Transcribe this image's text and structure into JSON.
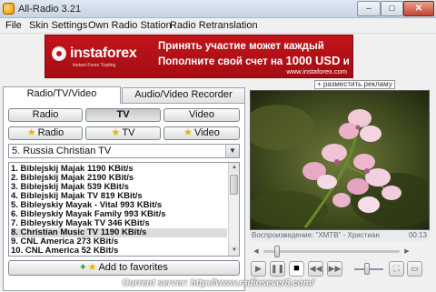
{
  "window": {
    "title": "All-Radio 3.21",
    "min": "–",
    "max": "□",
    "close": "✕"
  },
  "menu": [
    "File",
    "Skin Settings",
    "Own Radio Station",
    "Radio Retranslation"
  ],
  "banner": {
    "logo_text": "instaforex",
    "logo_sub": "Instant Forex Trading",
    "line1": "Принять участие может каждый",
    "line2_pre": "Пополните свой счет на ",
    "line2_highlight": "1000 USD",
    "line2_post": " и Вы в игре!",
    "url": "www.instaforex.com",
    "ad_link": "+ разместить рекламу"
  },
  "tabs": [
    {
      "label": "Radio/TV/Video",
      "active": true
    },
    {
      "label": "Audio/Video Recorder",
      "active": false
    }
  ],
  "mode_buttons": [
    {
      "label": "Radio",
      "active": false
    },
    {
      "label": "TV",
      "active": true
    },
    {
      "label": "Video",
      "active": false
    }
  ],
  "fav_buttons": [
    "Radio",
    "TV",
    "Video"
  ],
  "category": {
    "selected": "5. Russia Christian TV"
  },
  "channels": [
    "1. Biblejskij Majak 1190 KBit/s",
    "2. Biblejskij Majak 2190 KBit/s",
    "3. Biblejskij Majak 539 KBit/s",
    "4. Biblejskij Majak TV 819 KBit/s",
    "5. Bibleyskiy Mayak - Vital 993 KBit/s",
    "6. Bibleyskiy Mayak Family 993 KBit/s",
    "7. Bibleyskiy Mayak TV 346 KBit/s",
    "8. Christian Music TV 1190 KBit/s",
    "9. CNL America 273 KBit/s",
    "10. CNL America 52 KBit/s"
  ],
  "selected_channel_index": 7,
  "add_favorites": "Add to favorites",
  "player": {
    "caption": "Воспроизведение: \"ХМТВ\" - Христиан",
    "time": "00:13",
    "seek_fraction": 0.08,
    "volume_fraction": 0.45
  },
  "status": "Current server: http://www.radiosever8.com/",
  "colors": {
    "banner_red": "#c2141a",
    "selection": "#dcdcdc",
    "star": "#e8b400",
    "plus": "#1a8a1a"
  }
}
